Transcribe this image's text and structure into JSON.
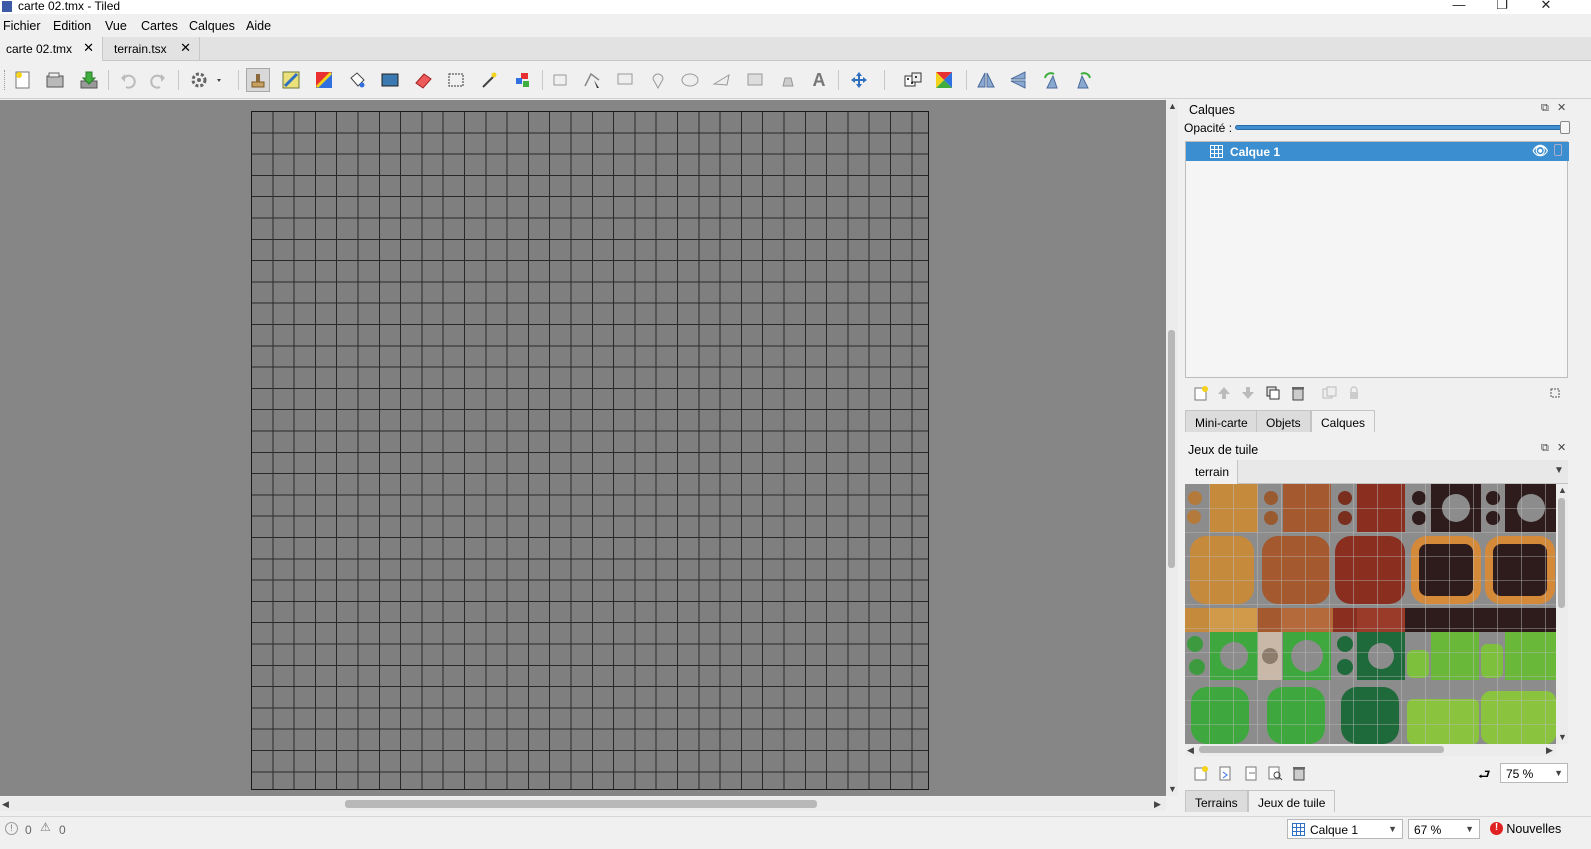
{
  "window": {
    "title": "carte 02.tmx - Tiled",
    "minimize": "—",
    "maximize": "❐",
    "close": "✕"
  },
  "menu": [
    "Fichier",
    "Edition",
    "Vue",
    "Cartes",
    "Calques",
    "Aide"
  ],
  "doc_tabs": [
    {
      "label": "carte 02.tmx",
      "active": true
    },
    {
      "label": "terrain.tsx",
      "active": false
    }
  ],
  "layers_panel": {
    "title": "Calques",
    "opacity_label": "Opacité :",
    "opacity_value": 1.0,
    "layers": [
      {
        "name": "Calque 1",
        "visible": true,
        "selected": true
      }
    ],
    "tabs": [
      {
        "label": "Mini-carte"
      },
      {
        "label": "Objets"
      },
      {
        "label": "Calques",
        "active": true
      }
    ]
  },
  "tilesets_panel": {
    "title": "Jeux de tuile",
    "tileset_tabs": [
      {
        "label": "terrain",
        "active": true
      }
    ],
    "zoom": "75 %",
    "tabs": [
      {
        "label": "Terrains"
      },
      {
        "label": "Jeux de tuile",
        "active": true
      }
    ]
  },
  "status": {
    "errors": "0",
    "warnings": "0",
    "current_layer": "Calque 1",
    "zoom": "67 %",
    "news": "Nouvelles"
  },
  "colors": {
    "accent": "#3b8ed0",
    "canvas_bg": "#868686",
    "map_bg": "#7f7f7f"
  }
}
